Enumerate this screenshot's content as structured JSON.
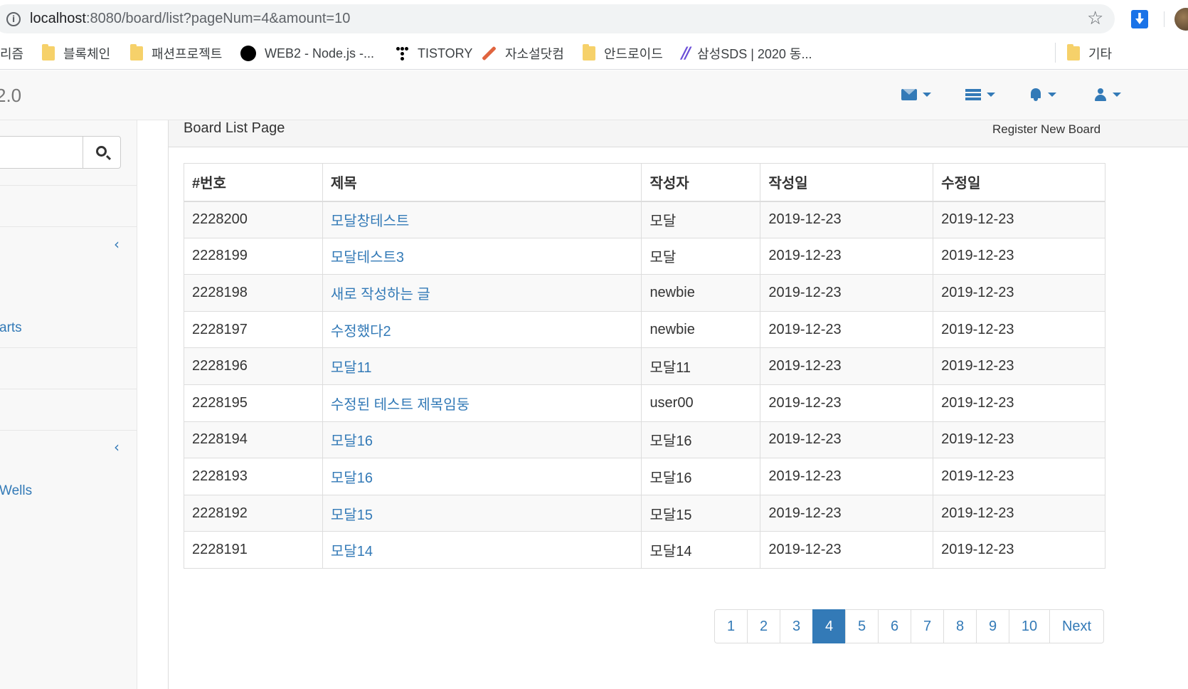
{
  "browser": {
    "url_host": "localhost",
    "url_rest": ":8080/board/list?pageNum=4&amount=10"
  },
  "bookmarks": [
    {
      "label": "리즘",
      "icon": "none"
    },
    {
      "label": "블록체인",
      "icon": "folder-icon"
    },
    {
      "label": "패션프로젝트",
      "icon": "folder-icon"
    },
    {
      "label": "WEB2 - Node.js -...",
      "icon": "black-circle-icon"
    },
    {
      "label": "TISTORY",
      "icon": "tistory-icon"
    },
    {
      "label": "자소설닷컴",
      "icon": "pen-icon"
    },
    {
      "label": "안드로이드",
      "icon": "folder-icon"
    },
    {
      "label": "삼성SDS | 2020 동...",
      "icon": "slash-icon"
    },
    {
      "label": "기타",
      "icon": "folder-icon"
    }
  ],
  "navbar": {
    "brand": "2.0"
  },
  "sidebar": {
    "link_charts": "arts",
    "link_wells": "Wells"
  },
  "panel": {
    "title": "Board List Page",
    "register_button": "Register New Board"
  },
  "table": {
    "headers": [
      "#번호",
      "제목",
      "작성자",
      "작성일",
      "수정일"
    ],
    "rows": [
      [
        "2228200",
        "모달창테스트",
        "모달",
        "2019-12-23",
        "2019-12-23"
      ],
      [
        "2228199",
        "모달테스트3",
        "모달",
        "2019-12-23",
        "2019-12-23"
      ],
      [
        "2228198",
        "새로 작성하는 글",
        "newbie",
        "2019-12-23",
        "2019-12-23"
      ],
      [
        "2228197",
        "수정했다2",
        "newbie",
        "2019-12-23",
        "2019-12-23"
      ],
      [
        "2228196",
        "모달11",
        "모달11",
        "2019-12-23",
        "2019-12-23"
      ],
      [
        "2228195",
        "수정된 테스트 제목임둥",
        "user00",
        "2019-12-23",
        "2019-12-23"
      ],
      [
        "2228194",
        "모달16",
        "모달16",
        "2019-12-23",
        "2019-12-23"
      ],
      [
        "2228193",
        "모달16",
        "모달16",
        "2019-12-23",
        "2019-12-23"
      ],
      [
        "2228192",
        "모달15",
        "모달15",
        "2019-12-23",
        "2019-12-23"
      ],
      [
        "2228191",
        "모달14",
        "모달14",
        "2019-12-23",
        "2019-12-23"
      ]
    ]
  },
  "pagination": {
    "pages": [
      "1",
      "2",
      "3",
      "4",
      "5",
      "6",
      "7",
      "8",
      "9",
      "10"
    ],
    "current": "4",
    "next_label": "Next"
  },
  "colors": {
    "link": "#337ab7",
    "active_page_bg": "#337ab7"
  }
}
